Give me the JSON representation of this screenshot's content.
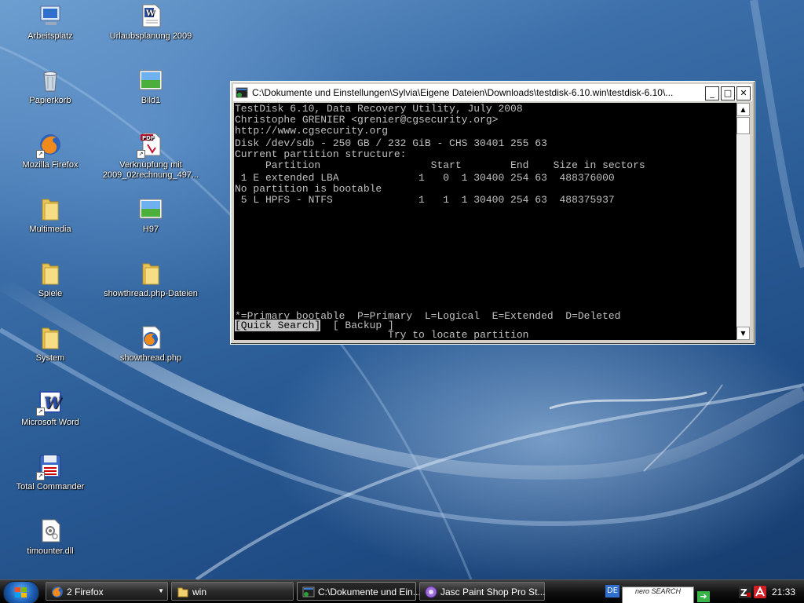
{
  "desktop_icons": [
    {
      "label": "Arbeitsplatz",
      "icon": "computer-icon"
    },
    {
      "label": "Urlaubsplanung 2009",
      "icon": "word-document-icon"
    },
    {
      "label": "Papierkorb",
      "icon": "recycle-bin-icon"
    },
    {
      "label": "Bild1",
      "icon": "image-file-icon"
    },
    {
      "label": "Mozilla Firefox",
      "icon": "firefox-icon"
    },
    {
      "label": "Verknüpfung mit 2009_02rechnung_497...",
      "icon": "pdf-file-icon"
    },
    {
      "label": "Multimedia",
      "icon": "folder-icon"
    },
    {
      "label": "H97",
      "icon": "image-file-icon"
    },
    {
      "label": "Spiele",
      "icon": "folder-icon"
    },
    {
      "label": "showthread.php-Dateien",
      "icon": "folder-icon"
    },
    {
      "label": "System",
      "icon": "folder-icon"
    },
    {
      "label": "showthread.php",
      "icon": "firefox-document-icon"
    },
    {
      "label": "Microsoft Word",
      "icon": "word-icon"
    },
    {
      "label": "Total Commander",
      "icon": "total-commander-icon"
    },
    {
      "label": "timounter.dll",
      "icon": "dll-file-icon"
    }
  ],
  "console": {
    "title": "C:\\Dokumente und Einstellungen\\Sylvia\\Eigene Dateien\\Downloads\\testdisk-6.10.win\\testdisk-6.10\\...",
    "lines": {
      "l1": "TestDisk 6.10, Data Recovery Utility, July 2008",
      "l2": "Christophe GRENIER <grenier@cgsecurity.org>",
      "l3": "http://www.cgsecurity.org",
      "l4": "",
      "l5": "Disk /dev/sdb - 250 GB / 232 GiB - CHS 30401 255 63",
      "l6": "Current partition structure:",
      "l7": "     Partition                  Start        End    Size in sectors",
      "l8": "",
      "l9": " 1 E extended LBA             1   0  1 30400 254 63  488376000",
      "l10": "No partition is bootable",
      "l11": " 5 L HPFS - NTFS              1   1  1 30400 254 63  488375937",
      "legend": "*=Primary bootable  P=Primary  L=Logical  E=Extended  D=Deleted",
      "menu_quick": "[Quick Search]",
      "menu_backup": "[ Backup ]",
      "hint": "Try to locate partition"
    }
  },
  "taskbar": {
    "items": [
      {
        "label": "2 Firefox",
        "icon": "firefox-icon",
        "dropdown": "▼"
      },
      {
        "label": "win",
        "icon": "folder-icon"
      },
      {
        "label": "C:\\Dokumente und Ein...",
        "icon": "console-icon"
      },
      {
        "label": "Jasc Paint Shop Pro St...",
        "icon": "paint-shop-pro-icon"
      }
    ],
    "language": "DE",
    "search_logo": "nero SEARCH",
    "clock": "21:33"
  },
  "colors": {
    "console_bg": "#000000",
    "console_text": "#c0c0c0",
    "desktop_blue": "#2a5b95"
  }
}
